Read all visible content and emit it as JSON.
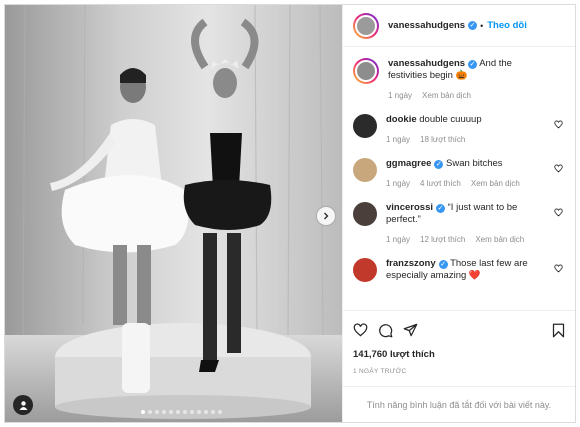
{
  "post": {
    "author": "vanessahudgens",
    "follow_label": "Theo dõi",
    "likes": "141,760 lượt thích",
    "posted": "1 NGÀY TRƯỚC",
    "comments_disabled": "Tính năng bình luận đã tắt đối với bài viết này.",
    "carousel_dots": 12,
    "active_dot": 0
  },
  "caption": {
    "username": "vanessahudgens",
    "text": "And the festivities begin 🎃",
    "age": "1 ngày",
    "translate": "Xem bản dịch"
  },
  "comments": [
    {
      "username": "dookie",
      "verified": false,
      "text": "double cuuuup",
      "age": "1 ngày",
      "likes": "18 lượt thích",
      "translate": ""
    },
    {
      "username": "ggmagree",
      "verified": true,
      "text": "Swan bitches",
      "age": "1 ngày",
      "likes": "4 lượt thích",
      "translate": "Xem bản dịch"
    },
    {
      "username": "vincerossi",
      "verified": true,
      "text": "“I just want to be perfect.”",
      "age": "1 ngày",
      "likes": "12 lượt thích",
      "translate": "Xem bản dịch"
    },
    {
      "username": "franzszony",
      "verified": true,
      "text": "Those last few are especially amazing ❤️",
      "age": "",
      "likes": "",
      "translate": ""
    }
  ],
  "colors": {
    "link": "#0095f6",
    "verified": "#3897f0",
    "muted": "#8e8e8e"
  },
  "icons": [
    "heart-icon",
    "comment-icon",
    "share-icon",
    "bookmark-icon",
    "chevron-right-icon",
    "user-tag-icon"
  ]
}
